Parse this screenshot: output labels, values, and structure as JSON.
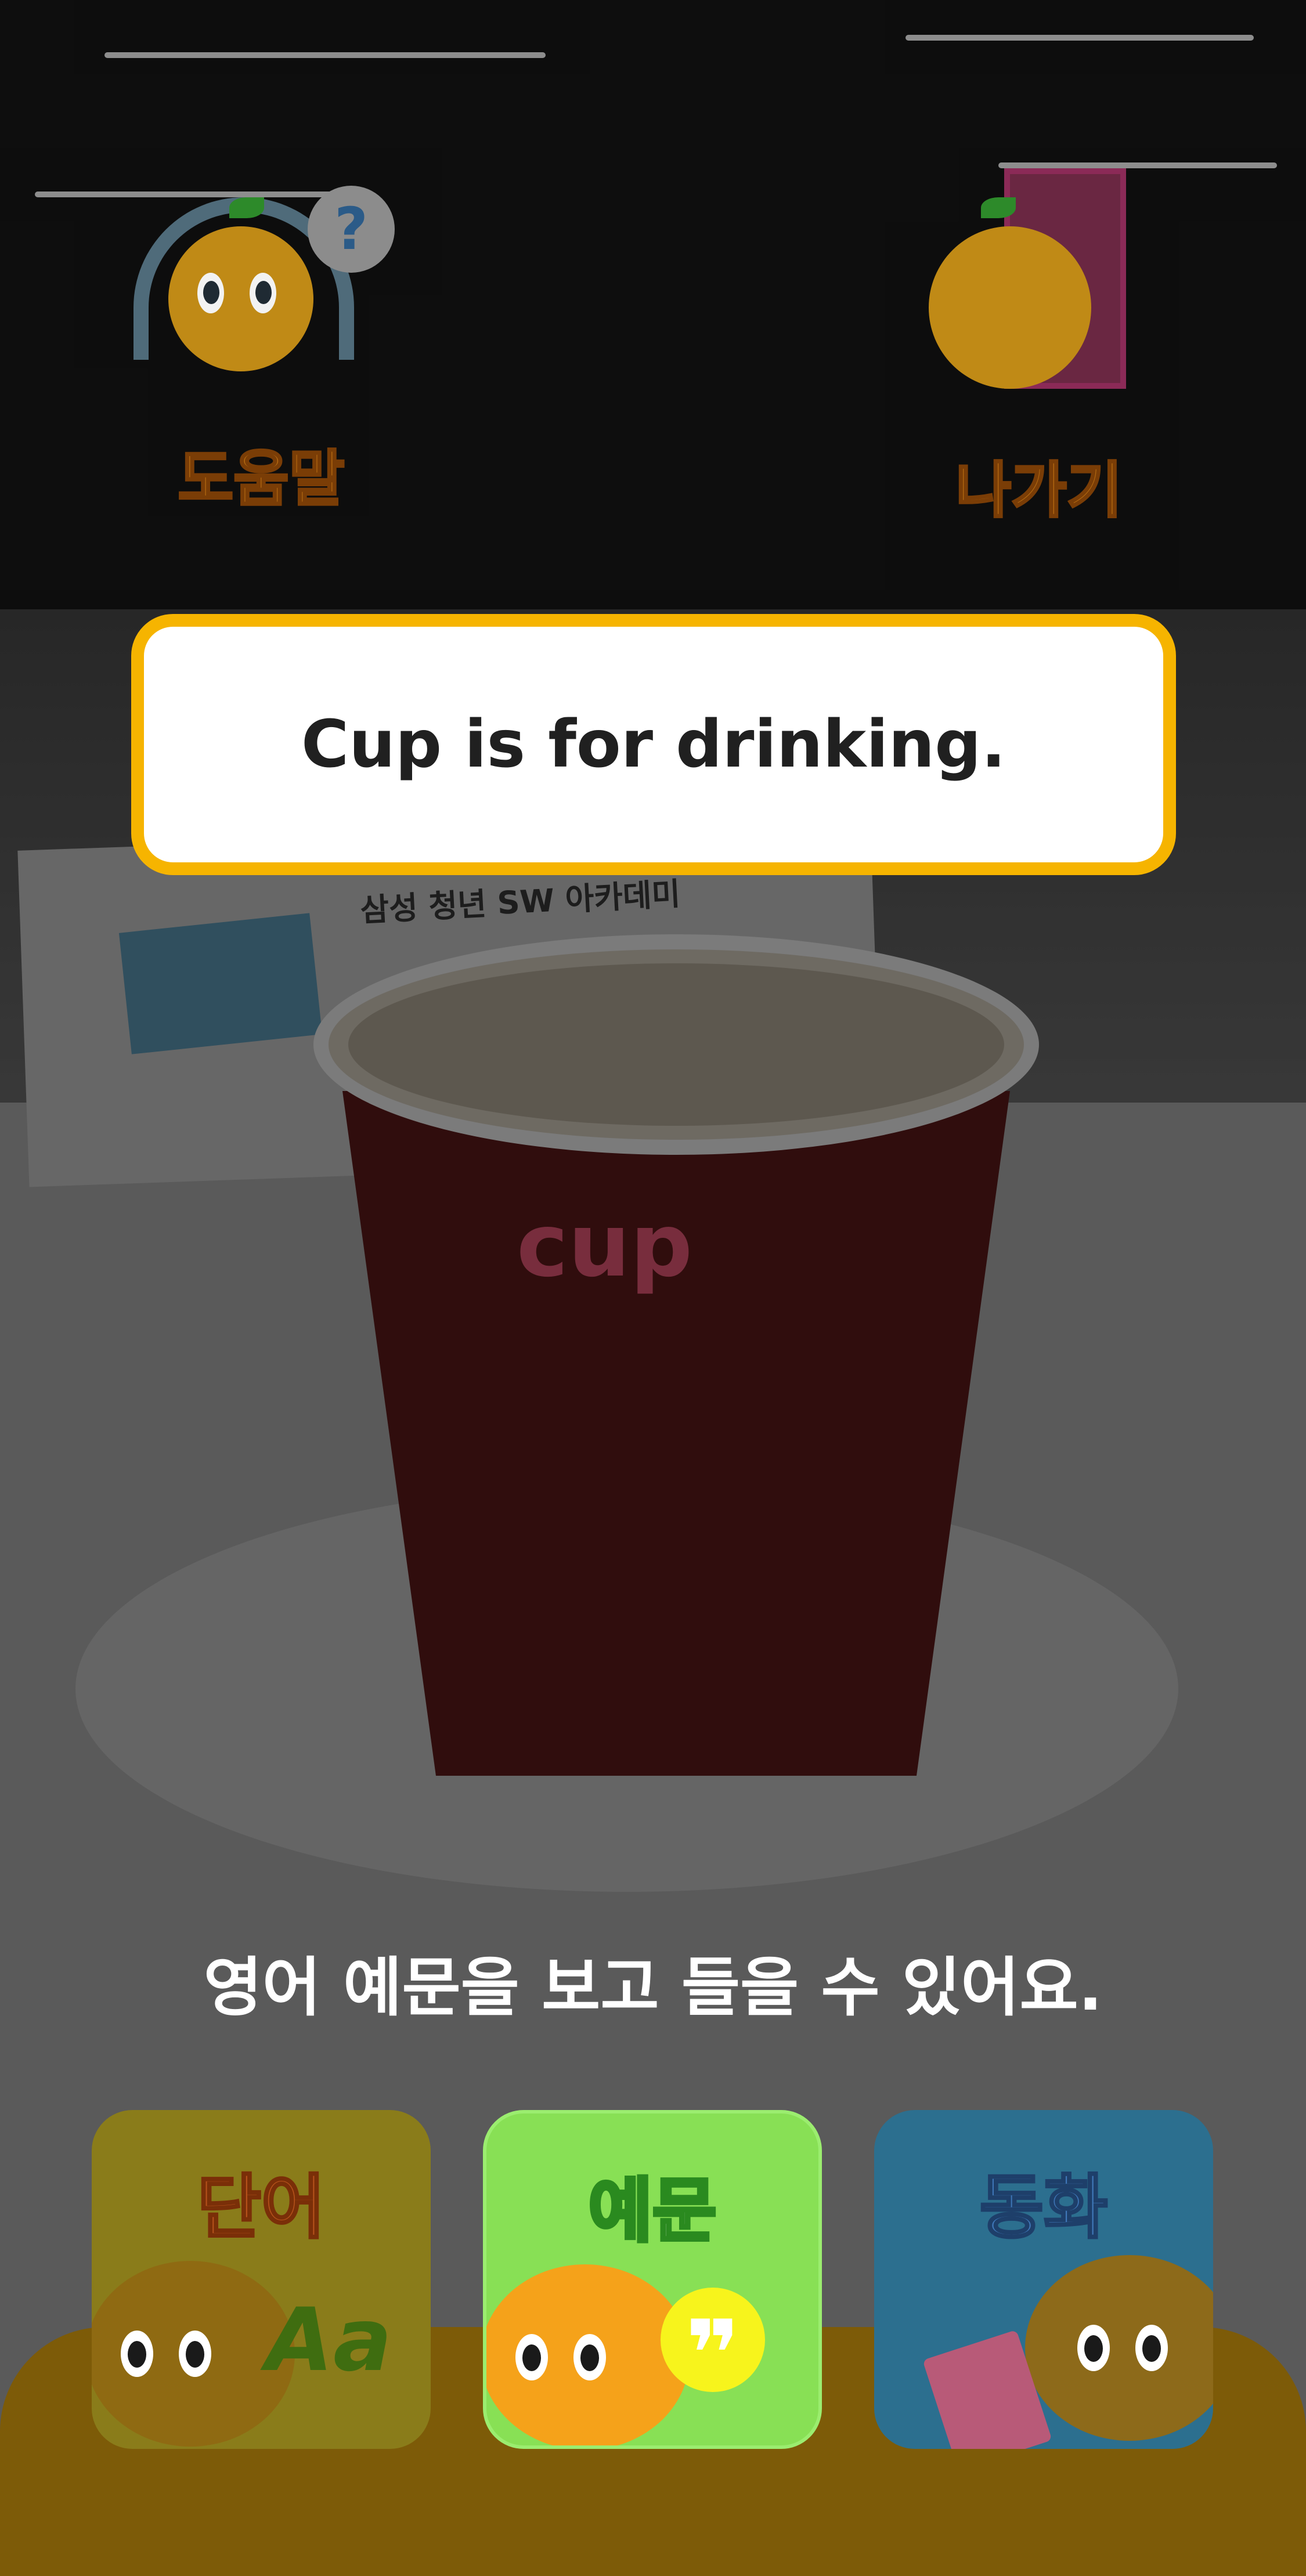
{
  "top_bar": {
    "help_label": "도움말",
    "exit_label": "나가기"
  },
  "camera_scene": {
    "sign_text": "삼성 청년 SW 아카데미",
    "cup_print": "cup"
  },
  "sentence": {
    "text": "Cup is for drinking."
  },
  "hint": {
    "text": "영어 예문을 보고 들을 수 있어요."
  },
  "modes": {
    "word_label": "단어",
    "example_label": "예문",
    "story_label": "동화",
    "word_icon_text": "Aa",
    "example_icon_text": "❞",
    "selected": "예문"
  },
  "colors": {
    "sentence_border": "#f6b400",
    "example_active": "#88e055",
    "bottom_bar": "#7d5b08"
  },
  "icons": {
    "help": "headset-question-mascot-icon",
    "exit": "door-mascot-icon",
    "word": "mascot-letters-icon",
    "example": "mascot-quote-icon",
    "story": "mascot-book-icon"
  }
}
